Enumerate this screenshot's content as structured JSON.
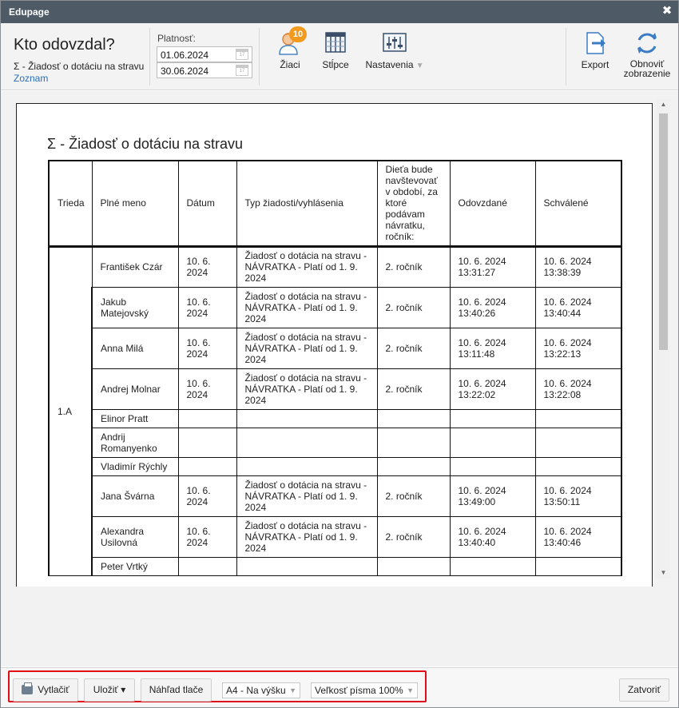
{
  "window": {
    "title": "Edupage",
    "close_glyph": "✖"
  },
  "header": {
    "title": "Kto odovzdal?",
    "subtitle": "Σ - Žiadosť o dotáciu na stravu",
    "list_link": "Zoznam"
  },
  "validity": {
    "label": "Platnosť:",
    "from": "01.06.2024",
    "to": "30.06.2024"
  },
  "tools": {
    "students": {
      "label": "Žiaci",
      "badge": "10",
      "icon": "student-icon"
    },
    "columns": {
      "label": "Stĺpce",
      "icon": "columns-icon"
    },
    "settings": {
      "label": "Nastavenia",
      "icon": "sliders-icon"
    },
    "export": {
      "label": "Export",
      "icon": "export-icon"
    },
    "refresh": {
      "label_line1": "Obnoviť",
      "label_line2": "zobrazenie",
      "icon": "refresh-icon"
    }
  },
  "report": {
    "title": "Σ - Žiadosť o dotáciu na stravu",
    "columns": [
      "Trieda",
      "Plné meno",
      "Dátum",
      "Typ žiadosti/vyhlásenia",
      "Dieťa bude navštevovať v období, za ktoré podávam návratku, ročník:",
      "Odovzdané",
      "Schválené"
    ],
    "class_name": "1.A",
    "rows": [
      {
        "name": "František Czár",
        "date": "10. 6. 2024",
        "type": "Žiadosť o dotácia na stravu - NÁVRATKA - Platí od 1. 9. 2024",
        "grade": "2. ročník",
        "submitted": "10. 6. 2024 13:31:27",
        "approved": "10. 6. 2024 13:38:39"
      },
      {
        "name": "Jakub Matejovský",
        "date": "10. 6. 2024",
        "type": "Žiadosť o dotácia na stravu - NÁVRATKA - Platí od 1. 9. 2024",
        "grade": "2. ročník",
        "submitted": "10. 6. 2024 13:40:26",
        "approved": "10. 6. 2024 13:40:44"
      },
      {
        "name": "Anna Milá",
        "date": "10. 6. 2024",
        "type": "Žiadosť o dotácia na stravu - NÁVRATKA - Platí od 1. 9. 2024",
        "grade": "2. ročník",
        "submitted": "10. 6. 2024 13:11:48",
        "approved": "10. 6. 2024 13:22:13"
      },
      {
        "name": "Andrej Molnar",
        "date": "10. 6. 2024",
        "type": "Žiadosť o dotácia na stravu - NÁVRATKA - Platí od 1. 9. 2024",
        "grade": "2. ročník",
        "submitted": "10. 6. 2024 13:22:02",
        "approved": "10. 6. 2024 13:22:08"
      },
      {
        "name": "Elinor Pratt",
        "date": "",
        "type": "",
        "grade": "",
        "submitted": "",
        "approved": ""
      },
      {
        "name": "Andrij Romanyenko",
        "date": "",
        "type": "",
        "grade": "",
        "submitted": "",
        "approved": ""
      },
      {
        "name": "Vladimír Rýchly",
        "date": "",
        "type": "",
        "grade": "",
        "submitted": "",
        "approved": ""
      },
      {
        "name": "Jana Švárna",
        "date": "10. 6. 2024",
        "type": "Žiadosť o dotácia na stravu - NÁVRATKA - Platí od 1. 9. 2024",
        "grade": "2. ročník",
        "submitted": "10. 6. 2024 13:49:00",
        "approved": "10. 6. 2024 13:50:11"
      },
      {
        "name": "Alexandra Usilovná",
        "date": "10. 6. 2024",
        "type": "Žiadosť o dotácia na stravu - NÁVRATKA - Platí od 1. 9. 2024",
        "grade": "2. ročník",
        "submitted": "10. 6. 2024 13:40:40",
        "approved": "10. 6. 2024 13:40:46"
      },
      {
        "name": "Peter Vrtký",
        "date": "",
        "type": "",
        "grade": "",
        "submitted": "",
        "approved": ""
      }
    ]
  },
  "footer": {
    "print": "Vytlačiť",
    "save": "Uložiť ▾",
    "preview": "Náhľad tlače",
    "paper": "A4 - Na výšku",
    "font_size": "Veľkosť písma 100%",
    "close": "Zatvoriť"
  },
  "colors": {
    "titlebar": "#4e5a66",
    "badge": "#f29a1d",
    "link": "#2a6fb8",
    "highlight": "#e0101a"
  }
}
